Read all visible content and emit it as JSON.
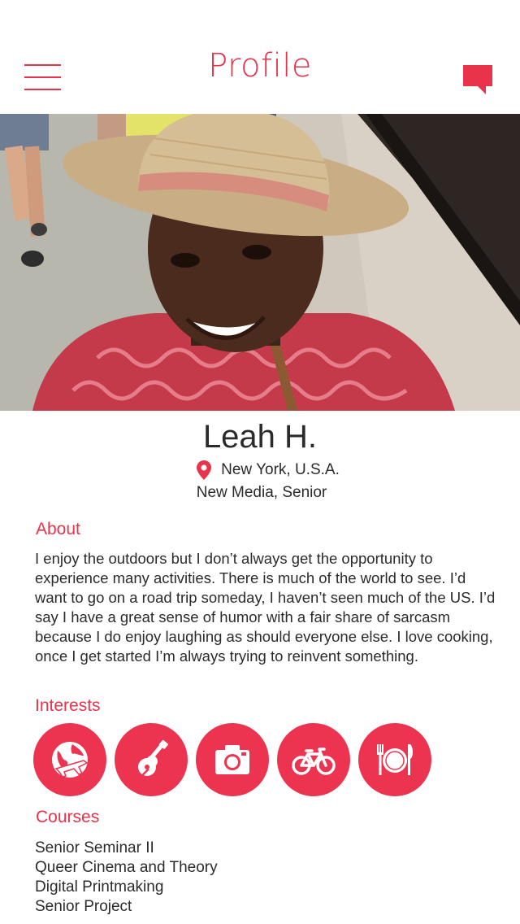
{
  "header": {
    "title": "Profile",
    "menu_icon": "hamburger-menu-icon",
    "chat_icon": "chat-bubble-icon"
  },
  "profile": {
    "name": "Leah H.",
    "location": "New York, U.S.A.",
    "major": "New Media, Senior",
    "location_icon": "map-pin-icon"
  },
  "about": {
    "title": "About",
    "text": "I enjoy the outdoors but I don’t always get the opportunity to experience many activities. There is much of the world to see. I’d want to go on a road trip someday, I haven’t seen much of the US. I’d say I have a great sense of humor with a fair share of sarcasm because I do enjoy laughing as should everyone else. I love cooking, once I get started I’m always trying to reinvent something."
  },
  "interests": {
    "title": "Interests",
    "items": [
      {
        "icon": "travel-globe-icon"
      },
      {
        "icon": "guitar-icon"
      },
      {
        "icon": "camera-icon"
      },
      {
        "icon": "bicycle-icon"
      },
      {
        "icon": "dining-icon"
      }
    ]
  },
  "courses": {
    "title": "Courses",
    "items": [
      "Senior Seminar II",
      "Queer Cinema and Theory",
      "Digital Printmaking",
      "Senior Project"
    ]
  },
  "colors": {
    "accent": "#e8334a",
    "text": "#2b2b2b",
    "background": "#ffffff"
  }
}
